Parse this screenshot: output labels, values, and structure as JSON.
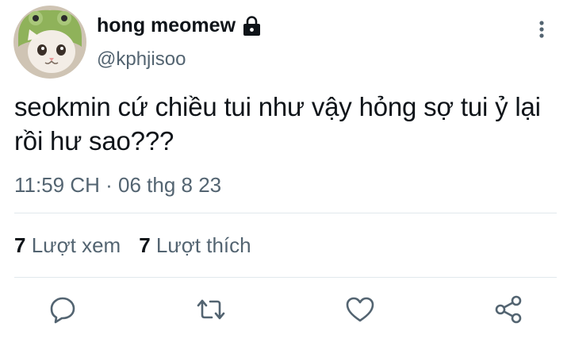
{
  "author": {
    "display_name": "hong meomew",
    "handle": "@kphjisoo",
    "protected_icon": "lock-icon",
    "avatar_icon": "cat-avatar"
  },
  "tweet": {
    "text": "seokmin cứ chiều tui như vậy hỏng sợ tui ỷ lại rồi hư sao???",
    "timestamp": "11:59 CH · 06 thg 8 23"
  },
  "stats": {
    "views_count": "7",
    "views_label": "Lượt xem",
    "likes_count": "7",
    "likes_label": "Lượt thích"
  },
  "actions": [
    "reply-icon",
    "retweet-icon",
    "like-icon",
    "share-icon"
  ],
  "colors": {
    "text": "#0f1419",
    "secondary": "#536471",
    "icon": "#536471",
    "divider": "#e1e8ed"
  }
}
